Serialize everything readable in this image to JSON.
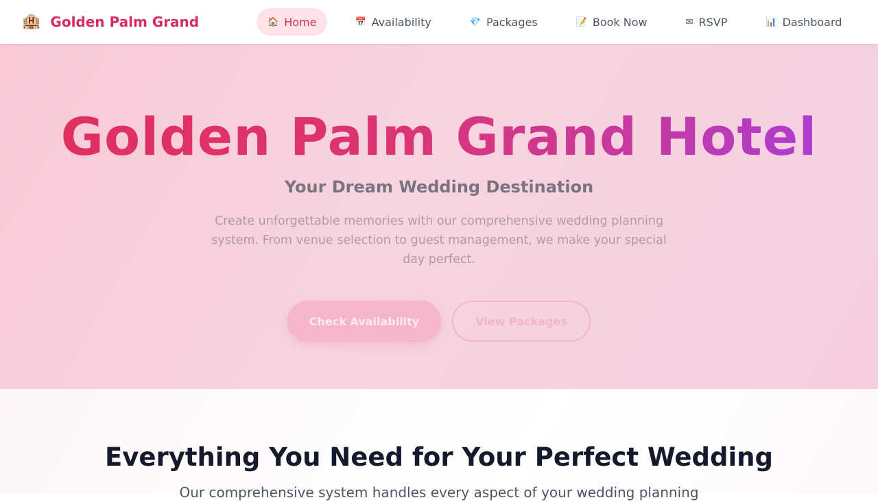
{
  "brand": {
    "icon": "🏨",
    "name": "Golden Palm Grand"
  },
  "nav": {
    "items": [
      {
        "icon": "🏠",
        "label": "Home",
        "active": true
      },
      {
        "icon": "📅",
        "label": "Availability"
      },
      {
        "icon": "💎",
        "label": "Packages"
      },
      {
        "icon": "📝",
        "label": "Book Now"
      },
      {
        "icon": "✉",
        "label": "RSVP"
      },
      {
        "icon": "📊",
        "label": "Dashboard"
      }
    ]
  },
  "hero": {
    "title": "Golden Palm Grand Hotel",
    "subtitle": "Your Dream Wedding Destination",
    "description": "Create unforgettable memories with our comprehensive wedding planning system. From venue selection to guest management, we make your special day perfect.",
    "primary_button": "Check Availability",
    "secondary_button": "View Packages"
  },
  "features": {
    "title": "Everything You Need for Your Perfect Wedding",
    "subtitle": "Our comprehensive system handles every aspect of your wedding planning"
  },
  "colors": {
    "brand": "#d82c5e",
    "active_nav_bg": "#fde3e8",
    "hero_bg": "#f7d0dc",
    "title_gradient_start": "#e02f5c",
    "title_gradient_end": "#a43ee0"
  }
}
